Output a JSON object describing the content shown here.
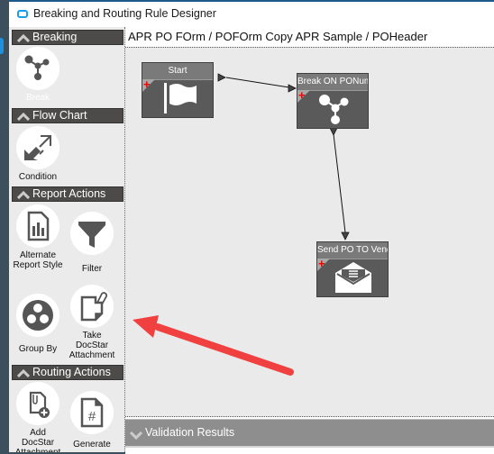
{
  "window": {
    "title": "Breaking and Routing Rule Designer",
    "accent_color": "#17a0e8"
  },
  "breadcrumb": "APR PO FOrm / POFOrm Copy APR Sample / POHeader",
  "palette": {
    "sections": [
      {
        "label": "Breaking",
        "tools": [
          {
            "label": "Break",
            "icon": "break-icon"
          }
        ]
      },
      {
        "label": "Flow Chart",
        "tools": [
          {
            "label": "Condition",
            "icon": "condition-arrows-icon"
          }
        ]
      },
      {
        "label": "Report Actions",
        "tools": [
          {
            "label": "Alternate Report Style",
            "icon": "report-chart-icon"
          },
          {
            "label": "Filter",
            "icon": "filter-funnel-icon"
          },
          {
            "label": "Group By",
            "icon": "group-circles-icon"
          },
          {
            "label": "Take DocStar Attachment",
            "icon": "paperclip-document-icon"
          }
        ]
      },
      {
        "label": "Routing Actions",
        "tools": [
          {
            "label": "Add DocStar Attachment",
            "icon": "add-attachment-icon"
          },
          {
            "label": "Generate",
            "icon": "hash-document-icon"
          }
        ]
      }
    ]
  },
  "flow": {
    "nodes": [
      {
        "title": "Start",
        "icon": "flag-icon"
      },
      {
        "title": "Break ON PONum",
        "icon": "break-icon"
      },
      {
        "title": "Send PO TO Vendor",
        "icon": "envelope-icon"
      }
    ],
    "connections": [
      {
        "from": "Start",
        "to": "Break ON PONum"
      },
      {
        "from": "Break ON PONum",
        "to": "Send PO TO Vendor"
      }
    ]
  },
  "validation_panel": {
    "label": "Validation Results"
  },
  "annotation": {
    "type": "red-arrow",
    "color": "#f04040",
    "points_to": "palette"
  }
}
